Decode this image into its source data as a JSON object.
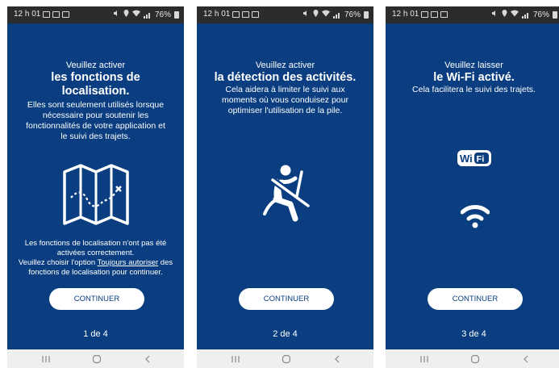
{
  "status_bar": {
    "time": "12 h 01",
    "battery": "76%"
  },
  "screens": [
    {
      "intro": "Veuillez activer",
      "headline_lines": [
        "les fonctions de",
        "localisation."
      ],
      "body_lines": [
        "Elles sont seulement utilisés lorsque",
        "nécessaire pour soutenir les",
        "fonctionnalités de votre application et",
        "le suivi des trajets."
      ],
      "illustration": "map-icon",
      "warning_line1": "Les fonctions de localisation n'ont pas été",
      "warning_line2": "activées correctement.",
      "warning_line3_pre": "Veuillez choisir l'option ",
      "warning_link": "Toujours autoriser",
      "warning_line3_post": " des",
      "warning_line4": "fonctions de localisation pour continuer.",
      "button": "CONTINUER",
      "page": "1 de 4"
    },
    {
      "intro": "Veuillez activer",
      "headline": "la détection des activités.",
      "body_lines": [
        "Cela aidera à limiter le suivi aux",
        "moments où vous conduisez pour",
        "optimiser l'utilisation de la pile."
      ],
      "illustration": "seatbelt-driver-icon",
      "button": "CONTINUER",
      "page": "2 de 4"
    },
    {
      "intro": "Veuillez laisser",
      "headline": "le Wi-Fi activé.",
      "body_lines": [
        "Cela facilitera le suivi des trajets."
      ],
      "wifi_logo": {
        "wi": "Wi",
        "fi": "Fi"
      },
      "illustration": "wifi-signal-icon",
      "button": "CONTINUER",
      "page": "3 de 4"
    }
  ],
  "colors": {
    "background": "#0a3e80",
    "status_bar": "#2c2c2c",
    "nav_bar": "#efefef",
    "button_bg": "#ffffff",
    "button_text": "#0a3e80"
  }
}
